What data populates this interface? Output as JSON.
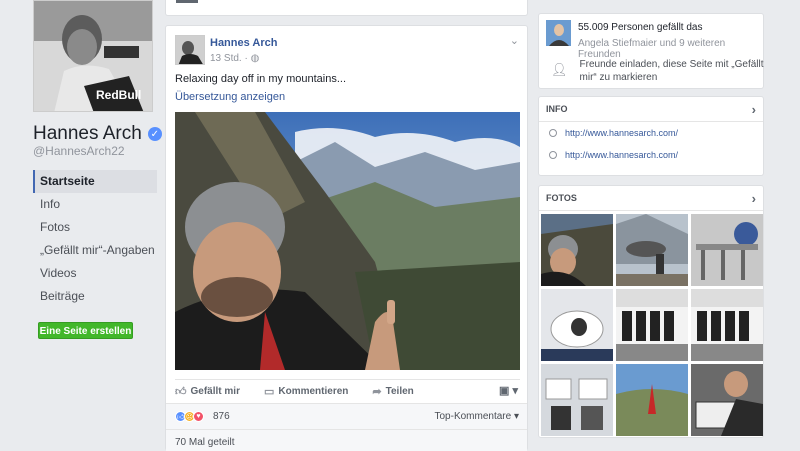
{
  "profile": {
    "name": "Hannes Arch",
    "verified_icon": "verified-check-icon",
    "handle": "@HannesArch22"
  },
  "nav": {
    "items": [
      {
        "label": "Startseite",
        "active": true
      },
      {
        "label": "Info",
        "active": false
      },
      {
        "label": "Fotos",
        "active": false
      },
      {
        "label": "„Gefällt mir“-Angaben",
        "active": false
      },
      {
        "label": "Videos",
        "active": false
      },
      {
        "label": "Beiträge",
        "active": false
      }
    ],
    "create_page_label": "Eine Seite erstellen"
  },
  "post": {
    "author": "Hannes Arch",
    "time": "13 Std. ·",
    "privacy_icon": "globe-icon",
    "text": "Relaxing day off in my mountains...",
    "translate_link": "Übersetzung anzeigen",
    "actions": {
      "like": "Gefällt mir",
      "comment": "Kommentieren",
      "share": "Teilen"
    },
    "reaction_count": "876",
    "top_comments": "Top-Kommentare ▾",
    "shares": "70 Mal geteilt"
  },
  "likes": {
    "count_text": "55.009 Personen gefällt das",
    "friends_text": "Angela Stiefmaier und 9 weiteren Freunden",
    "invite_text": "Freunde einladen, diese Seite mit „Gefällt mir“ zu markieren"
  },
  "info": {
    "header": "INFO",
    "links": [
      "http://www.hannesarch.com/",
      "http://www.hannesarch.com/"
    ]
  },
  "photos": {
    "header": "FOTOS"
  },
  "colors": {
    "link": "#365899",
    "accent": "#4267b2",
    "create_button": "#42b72a",
    "background": "#e9ebee"
  }
}
